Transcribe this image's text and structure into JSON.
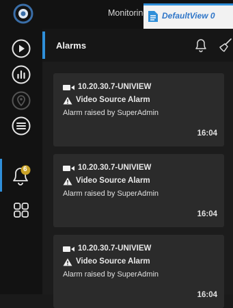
{
  "topbar": {
    "monitoring_label": "Monitoring",
    "view_label": "DefaultView 0"
  },
  "sidebar": {
    "alarm_badge": "6"
  },
  "header": {
    "title": "Alarms"
  },
  "alarms": [
    {
      "device": "10.20.30.7-UNIVIEW",
      "type": "Video Source Alarm",
      "raised_by": "Alarm raised by SuperAdmin",
      "time": "16:04"
    },
    {
      "device": "10.20.30.7-UNIVIEW",
      "type": "Video Source Alarm",
      "raised_by": "Alarm raised by SuperAdmin",
      "time": "16:04"
    },
    {
      "device": "10.20.30.7-UNIVIEW",
      "type": "Video Source Alarm",
      "raised_by": "Alarm raised by SuperAdmin",
      "time": "16:04"
    }
  ],
  "colors": {
    "accent": "#2f8fd9",
    "badge": "#c9a227",
    "card": "#2b2b2b",
    "background": "#1c1c1c"
  }
}
